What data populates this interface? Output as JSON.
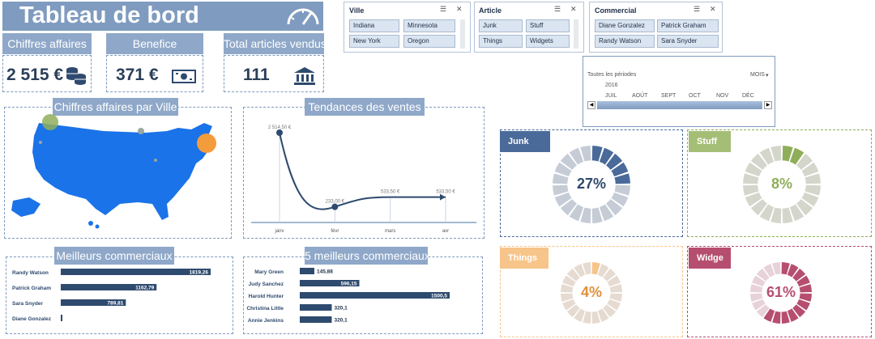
{
  "title": "Tableau de bord",
  "kpis": [
    {
      "label": "Chiffres affaires",
      "value": "2 515 €",
      "icon": "coins-icon"
    },
    {
      "label": "Benefice",
      "value": "371 €",
      "icon": "banknote-icon"
    },
    {
      "label": "Total articles vendus",
      "value": "111",
      "icon": "bank-icon"
    }
  ],
  "slicers": {
    "ville": {
      "title": "Ville",
      "items": [
        "Indiana",
        "Minnesota",
        "New York",
        "Oregon"
      ]
    },
    "article": {
      "title": "Article",
      "items": [
        "Junk",
        "Stuff",
        "Things",
        "Widgets"
      ]
    },
    "commercial": {
      "title": "Commercial",
      "items": [
        "Diane Gonzalez",
        "Patrick Graham",
        "Randy Watson",
        "Sara Snyder"
      ]
    }
  },
  "timeline": {
    "header": "Toutes les périodes",
    "unit": "MOIS",
    "year": "2016",
    "months": [
      "JUIL",
      "AOÛT",
      "SEPT",
      "OCT",
      "NOV",
      "DÉC"
    ]
  },
  "panels": {
    "map_title": "Chiffres affaires par Ville",
    "trend_title": "Tendances des ventes",
    "best_title": "Meilleurs commerciaux",
    "top5_title": "5 meilleurs commerciaux"
  },
  "colors": {
    "primary": "#2e4a6e",
    "accent": "#8fa8c9",
    "map": "#1a73e8"
  },
  "chart_data": [
    {
      "type": "line",
      "title": "Tendances des ventes",
      "x": [
        "janv",
        "févr",
        "mars",
        "avr"
      ],
      "y": [
        2514.5,
        233.0,
        533.5,
        533.5
      ],
      "labels": [
        "2 514,50 €",
        "233,00 €",
        "533,50 €",
        "533,50 €"
      ]
    },
    {
      "type": "bar",
      "title": "Meilleurs commerciaux",
      "categories": [
        "Randy Watson",
        "Patrick Graham",
        "Sara Snyder",
        "Diane Gonzalez"
      ],
      "values": [
        1819.26,
        1162.79,
        789.81,
        0
      ],
      "labels": [
        "1819,26",
        "1162,79",
        "789,81",
        ""
      ]
    },
    {
      "type": "bar",
      "title": "5 meilleurs commerciaux",
      "categories": [
        "Mary Green",
        "Judy Sanchez",
        "Harold Hunter",
        "Christina Little",
        "Annie Jenkins"
      ],
      "values": [
        145.88,
        596.15,
        1500.5,
        320.1,
        320.1
      ],
      "labels": [
        "145,88",
        "596,15",
        "1500,5",
        "320,1",
        "320,1"
      ]
    },
    {
      "type": "pie",
      "donuts": [
        {
          "name": "Junk",
          "value": 27,
          "label": "27%",
          "color": "#4a6a9a",
          "track": "#c5ccd6",
          "text": "#2e4a6e"
        },
        {
          "name": "Stuff",
          "value": 8,
          "label": "8%",
          "color": "#8fae5a",
          "track": "#d4d6cc",
          "text": "#8fae5a"
        },
        {
          "name": "Things",
          "value": 4,
          "label": "4%",
          "color": "#f7c48a",
          "track": "#e6dbd1",
          "text": "#e0903a"
        },
        {
          "name": "Widge",
          "value": 61,
          "label": "61%",
          "color": "#b64e70",
          "track": "#e8d2da",
          "text": "#b64e70"
        }
      ]
    }
  ]
}
